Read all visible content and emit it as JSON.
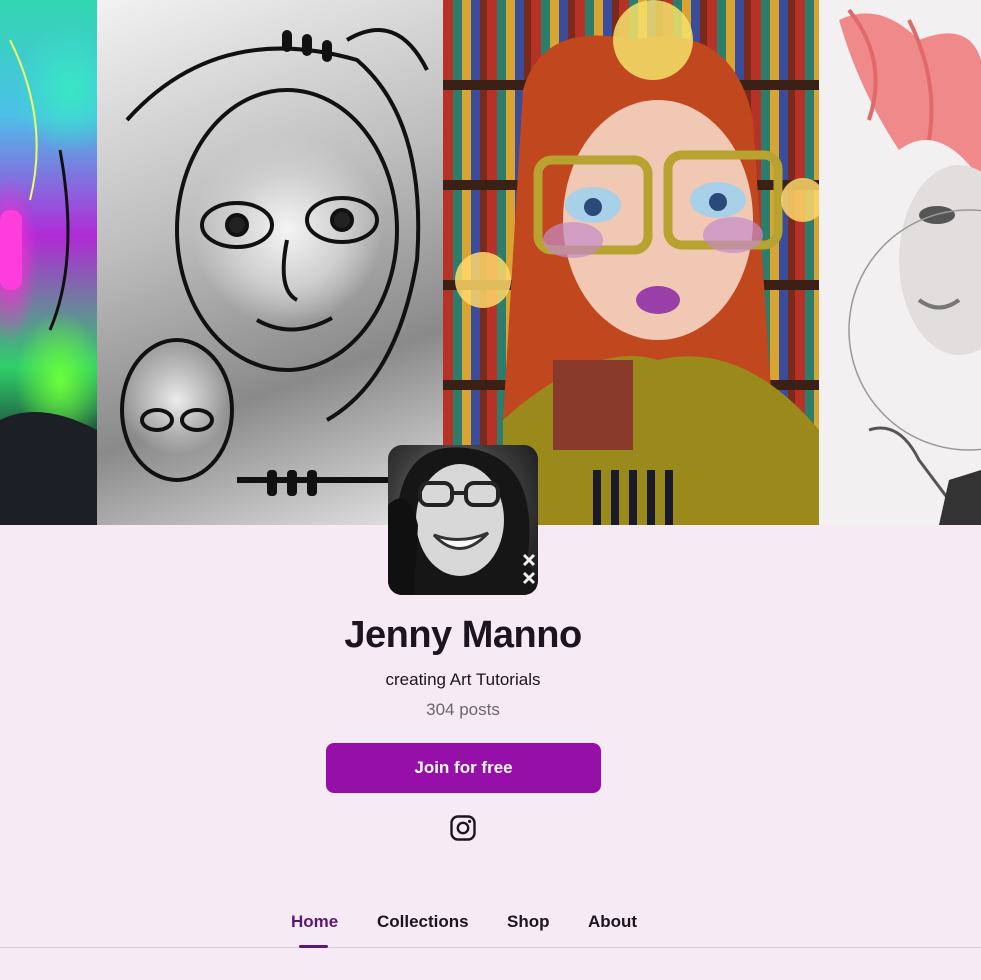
{
  "banner": {
    "image_alt": "Artwork banner"
  },
  "creator": {
    "name": "Jenny Manno",
    "tagline": "creating Art Tutorials",
    "post_count": "304 posts",
    "avatar_alt": "Jenny Manno profile photo"
  },
  "actions": {
    "join_label": "Join for free",
    "accent_color": "#960fa8"
  },
  "social": {
    "instagram_icon": "instagram-icon"
  },
  "tabs": [
    {
      "label": "Home",
      "active": true
    },
    {
      "label": "Collections",
      "active": false
    },
    {
      "label": "Shop",
      "active": false
    },
    {
      "label": "About",
      "active": false
    }
  ]
}
